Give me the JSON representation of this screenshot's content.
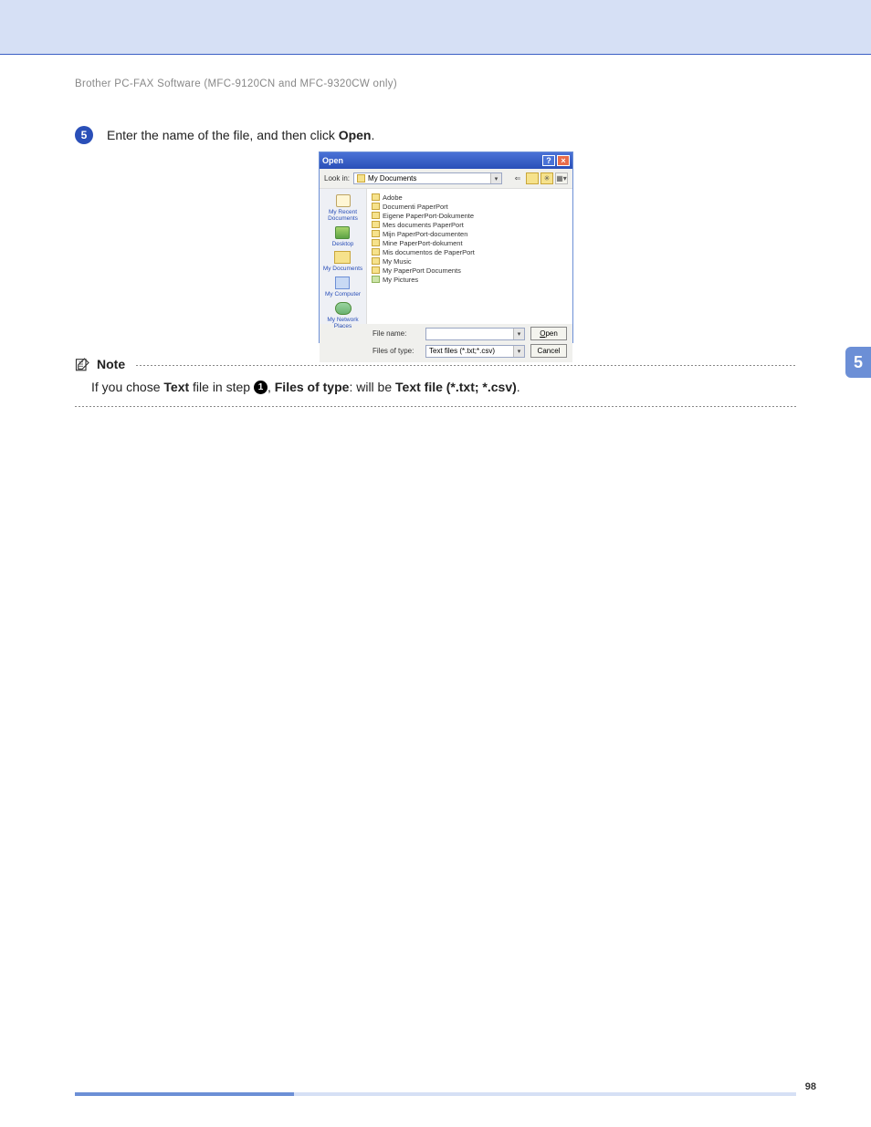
{
  "header": {
    "running_head": "Brother PC-FAX Software (MFC-9120CN and MFC-9320CW only)"
  },
  "step": {
    "number": "5",
    "text_before": "Enter the name of the file, and then click ",
    "bold_word": "Open",
    "text_after": "."
  },
  "dialog": {
    "title": "Open",
    "lookin_label": "Look in:",
    "lookin_value": "My Documents",
    "sidebar": [
      {
        "label": "My Recent Documents"
      },
      {
        "label": "Desktop"
      },
      {
        "label": "My Documents"
      },
      {
        "label": "My Computer"
      },
      {
        "label": "My Network Places"
      }
    ],
    "files": [
      {
        "name": "Adobe",
        "type": "folder"
      },
      {
        "name": "Documenti PaperPort",
        "type": "folder"
      },
      {
        "name": "Eigene PaperPort-Dokumente",
        "type": "folder"
      },
      {
        "name": "Mes documents PaperPort",
        "type": "folder"
      },
      {
        "name": "Mijn PaperPort-documenten",
        "type": "folder"
      },
      {
        "name": "Mine PaperPort-dokument",
        "type": "folder"
      },
      {
        "name": "Mis documentos de PaperPort",
        "type": "folder"
      },
      {
        "name": "My Music",
        "type": "music"
      },
      {
        "name": "My PaperPort Documents",
        "type": "folder"
      },
      {
        "name": "My Pictures",
        "type": "pictures"
      }
    ],
    "filename_label": "File name:",
    "filename_value": "",
    "filetype_label": "Files of type:",
    "filetype_value": "Text files (*.txt;*.csv)",
    "open_btn": "Open",
    "cancel_btn": "Cancel"
  },
  "note": {
    "heading": "Note",
    "body_before": "If you chose ",
    "bold1": "Text",
    "body_mid1": " file in step ",
    "inline_num": "1",
    "body_mid2": ", ",
    "bold2": "Files of type",
    "body_mid3": ": will be ",
    "bold3": "Text file (*.txt; *.csv)",
    "body_after": "."
  },
  "chapter_tab": "5",
  "page_number": "98"
}
